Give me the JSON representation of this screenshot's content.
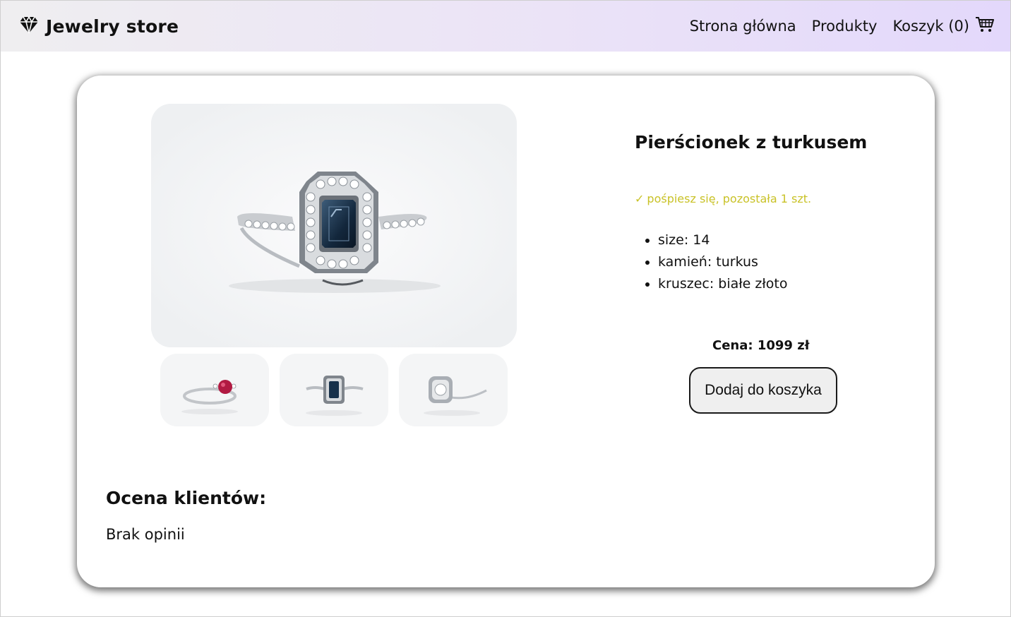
{
  "header": {
    "brand": "Jewelry store",
    "nav": {
      "home": "Strona główna",
      "products": "Produkty",
      "cart": "Koszyk (0)"
    }
  },
  "product": {
    "title": "Pierścionek z turkusem",
    "stock_icon": "✓",
    "stock_text": "pośpiesz się, pozostała 1 szt.",
    "specs": [
      "size: 14",
      "kamień: turkus",
      "kruszec: białe złoto"
    ],
    "price_label": "Cena:",
    "price_value": "1099 zł",
    "add_to_cart": "Dodaj do koszyka",
    "stock_color": "#c9c227",
    "thumbnails": [
      "ring-ruby-icon",
      "ring-sapphire-icon",
      "ring-diamond-icon"
    ]
  },
  "reviews": {
    "title": "Ocena klientów:",
    "empty": "Brak opinii"
  }
}
